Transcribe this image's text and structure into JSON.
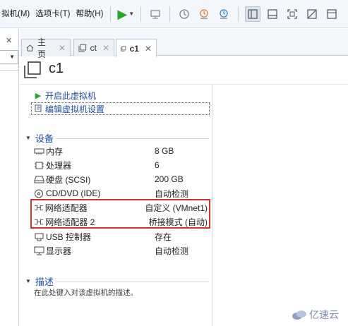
{
  "menubar": {
    "items": [
      "拟机(M)",
      "选项卡(T)",
      "帮助(H)"
    ]
  },
  "toolbar": {
    "icons": [
      "play-icon",
      "dropdown-icon",
      "send-keys-icon",
      "snapshot-icon",
      "revert-snapshot-icon",
      "snapshot-manager-icon",
      "library-view-icon",
      "console-view-icon",
      "fullscreen-icon",
      "unity-icon",
      "thumbnail-icon"
    ]
  },
  "tabs": [
    {
      "label": "主页",
      "icon": "home-icon"
    },
    {
      "label": "ct",
      "icon": "vm-icon"
    },
    {
      "label": "c1",
      "icon": "vm-icon",
      "active": true
    }
  ],
  "vm": {
    "title": "c1"
  },
  "actions": {
    "power_on": "开启此虚拟机",
    "edit_settings": "编辑虚拟机设置"
  },
  "devices": {
    "section_title": "设备",
    "rows": [
      {
        "name": "内存",
        "value": "8 GB",
        "icon": "memory-icon"
      },
      {
        "name": "处理器",
        "value": "6",
        "icon": "cpu-icon"
      },
      {
        "name": "硬盘 (SCSI)",
        "value": "200 GB",
        "icon": "harddisk-icon"
      },
      {
        "name": "CD/DVD (IDE)",
        "value": "自动检测",
        "icon": "cd-icon"
      },
      {
        "name": "网络适配器",
        "value": "自定义 (VMnet1)",
        "icon": "network-adapter-icon"
      },
      {
        "name": "网络适配器 2",
        "value": "桥接模式 (自动)",
        "icon": "network-adapter-icon"
      },
      {
        "name": "USB 控制器",
        "value": "存在",
        "icon": "usb-icon"
      },
      {
        "name": "显示器",
        "value": "自动检测",
        "icon": "display-icon"
      }
    ]
  },
  "description": {
    "section_title": "描述",
    "placeholder": "在此处键入对该虚拟机的描述。"
  },
  "watermark": {
    "text": "亿速云"
  },
  "colors": {
    "highlight_box": "#d9312b",
    "link_blue": "#1f4fa8",
    "play_green": "#2aa52a"
  }
}
